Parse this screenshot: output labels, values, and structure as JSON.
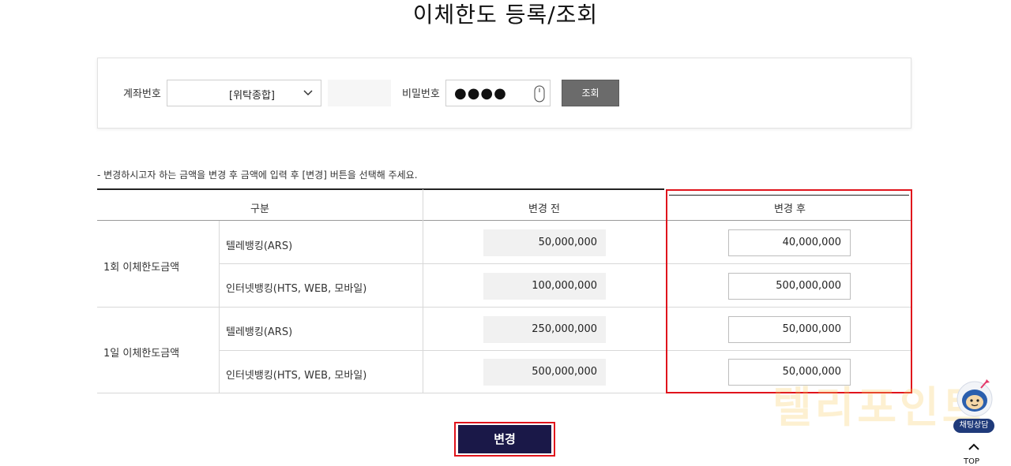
{
  "page": {
    "title": "이체한도 등록/조회"
  },
  "search": {
    "account_label": "계좌번호",
    "account_value": "[위탁종합]",
    "password_label": "비밀번호",
    "password_value": "●●●●",
    "query_button": "조회"
  },
  "notice": "- 변경하시고자 하는 금액을 변경 후 금액에 입력 후 [변경] 버튼을 선택해 주세요.",
  "table": {
    "headers": {
      "category": "구분",
      "before": "변경 전",
      "after": "변경 후"
    },
    "groups": [
      {
        "label": "1회 이체한도금액",
        "rows": [
          {
            "label": "텔레뱅킹(ARS)",
            "before": "50,000,000",
            "after": "40,000,000"
          },
          {
            "label": "인터넷뱅킹(HTS, WEB, 모바일)",
            "before": "100,000,000",
            "after": "500,000,000"
          }
        ]
      },
      {
        "label": "1일 이체한도금액",
        "rows": [
          {
            "label": "텔레뱅킹(ARS)",
            "before": "250,000,000",
            "after": "50,000,000"
          },
          {
            "label": "인터넷뱅킹(HTS, WEB, 모바일)",
            "before": "500,000,000",
            "after": "50,000,000"
          }
        ]
      }
    ]
  },
  "actions": {
    "change_button": "변경"
  },
  "widgets": {
    "chat_label": "채팅상담",
    "top_label": "TOP",
    "watermark": "텔리포인트"
  },
  "colors": {
    "accent_red": "#e0141c",
    "button_navy": "#1a1848",
    "query_gray": "#6b6b6b"
  }
}
